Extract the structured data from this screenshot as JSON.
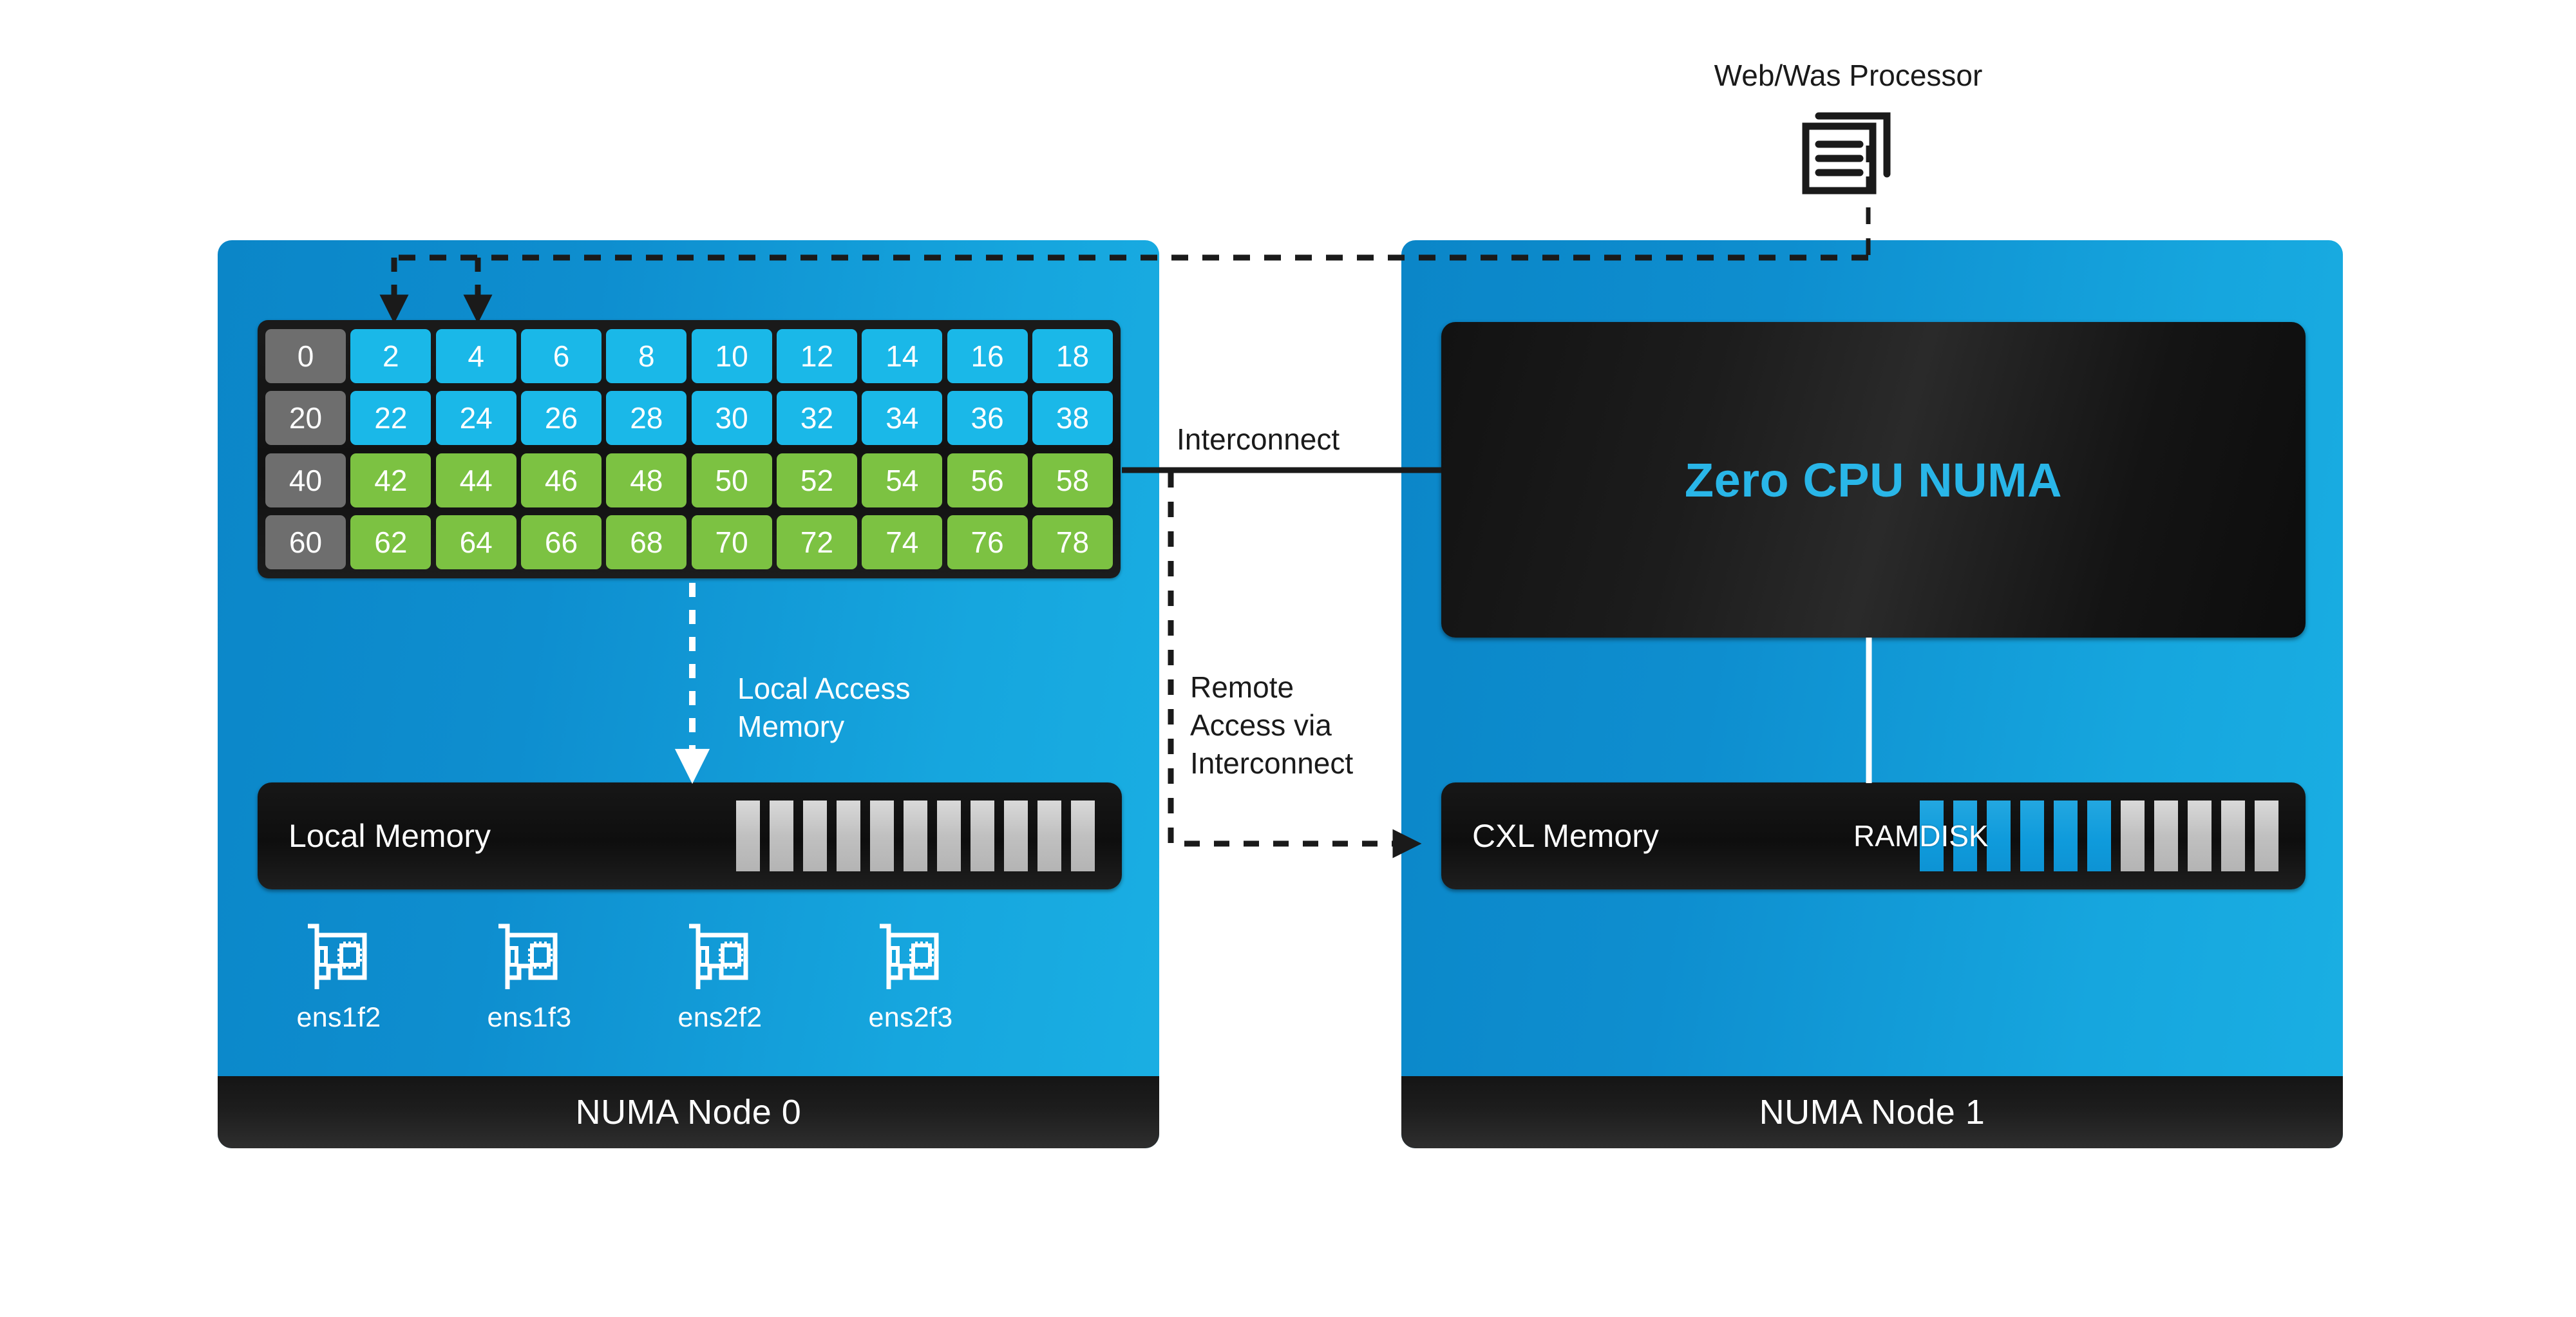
{
  "diagram": {
    "title": "NUMA node architecture with CXL memory",
    "colors": {
      "panel_blue": "#0e8ecf",
      "panel_blue_light": "#1aafe3",
      "cpu_cyan": "#1ab8e8",
      "cpu_green": "#7cc242",
      "cpu_gray": "#6e6e6e",
      "accent_cyan": "#29b6e8",
      "dark": "#111111",
      "slot_gray": "#c0c0c0",
      "slot_blue": "#0f9bdc"
    }
  },
  "web_was": {
    "title": "Web/Was Processor",
    "icon": "documents-icon"
  },
  "connectors": {
    "interconnect_label": "Interconnect",
    "remote_access_label": "Remote\nAccess via\nInterconnect",
    "local_access_label": "Local Access\nMemory"
  },
  "node0": {
    "footer_label": "NUMA Node 0",
    "cpu_grid": {
      "rows": [
        {
          "cells": [
            {
              "value": "0",
              "color": "gray"
            },
            {
              "value": "2",
              "color": "blue"
            },
            {
              "value": "4",
              "color": "blue"
            },
            {
              "value": "6",
              "color": "blue"
            },
            {
              "value": "8",
              "color": "blue"
            },
            {
              "value": "10",
              "color": "blue"
            },
            {
              "value": "12",
              "color": "blue"
            },
            {
              "value": "14",
              "color": "blue"
            },
            {
              "value": "16",
              "color": "blue"
            },
            {
              "value": "18",
              "color": "blue"
            }
          ]
        },
        {
          "cells": [
            {
              "value": "20",
              "color": "gray"
            },
            {
              "value": "22",
              "color": "blue"
            },
            {
              "value": "24",
              "color": "blue"
            },
            {
              "value": "26",
              "color": "blue"
            },
            {
              "value": "28",
              "color": "blue"
            },
            {
              "value": "30",
              "color": "blue"
            },
            {
              "value": "32",
              "color": "blue"
            },
            {
              "value": "34",
              "color": "blue"
            },
            {
              "value": "36",
              "color": "blue"
            },
            {
              "value": "38",
              "color": "blue"
            }
          ]
        },
        {
          "cells": [
            {
              "value": "40",
              "color": "gray"
            },
            {
              "value": "42",
              "color": "green"
            },
            {
              "value": "44",
              "color": "green"
            },
            {
              "value": "46",
              "color": "green"
            },
            {
              "value": "48",
              "color": "green"
            },
            {
              "value": "50",
              "color": "green"
            },
            {
              "value": "52",
              "color": "green"
            },
            {
              "value": "54",
              "color": "green"
            },
            {
              "value": "56",
              "color": "green"
            },
            {
              "value": "58",
              "color": "green"
            }
          ]
        },
        {
          "cells": [
            {
              "value": "60",
              "color": "gray"
            },
            {
              "value": "62",
              "color": "green"
            },
            {
              "value": "64",
              "color": "green"
            },
            {
              "value": "66",
              "color": "green"
            },
            {
              "value": "68",
              "color": "green"
            },
            {
              "value": "70",
              "color": "green"
            },
            {
              "value": "72",
              "color": "green"
            },
            {
              "value": "74",
              "color": "green"
            },
            {
              "value": "76",
              "color": "green"
            },
            {
              "value": "78",
              "color": "green"
            }
          ]
        }
      ]
    },
    "local_memory": {
      "label": "Local Memory",
      "slots": [
        "gray",
        "gray",
        "gray",
        "gray",
        "gray",
        "gray",
        "gray",
        "gray",
        "gray",
        "gray",
        "gray"
      ]
    },
    "nics": [
      {
        "label": "ens1f2",
        "icon": "network-card-icon"
      },
      {
        "label": "ens1f3",
        "icon": "network-card-icon"
      },
      {
        "label": "ens2f2",
        "icon": "network-card-icon"
      },
      {
        "label": "ens2f3",
        "icon": "network-card-icon"
      }
    ]
  },
  "node1": {
    "footer_label": "NUMA Node 1",
    "zero_cpu_numa_label": "Zero CPU NUMA",
    "cxl_memory": {
      "label": "CXL Memory",
      "overlay_label": "RAMDISK",
      "slots": [
        "blue",
        "blue",
        "blue",
        "blue",
        "blue",
        "blue",
        "gray",
        "gray",
        "gray",
        "gray",
        "gray"
      ]
    }
  }
}
